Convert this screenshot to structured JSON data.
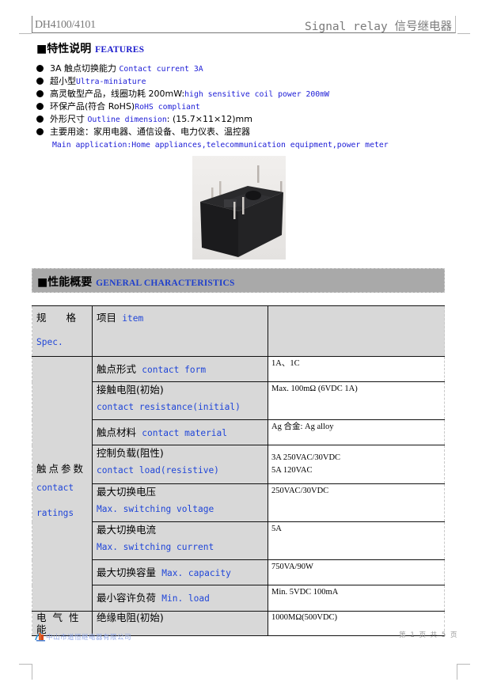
{
  "header": {
    "model": "DH4100/4101",
    "category": "Signal relay 信号继电器"
  },
  "features": {
    "title_zh": "■特性说明",
    "title_en": "FEATURES",
    "items": [
      {
        "zh": "3A 触点切换能力",
        "en": "Contact current 3A"
      },
      {
        "zh": "超小型",
        "en": "Ultra-miniature"
      },
      {
        "zh": "高灵敏型产品，线圈功耗 200mW:",
        "en": "high sensitive coil power 200mW"
      },
      {
        "zh": "环保产品(符合 RoHS)",
        "en": "RoHS compliant"
      },
      {
        "zh": "外形尺寸",
        "en": "Outline dimension",
        "suffix": ": (15.7×11×12)mm"
      },
      {
        "zh": "主要用途：家用电器、通信设备、电力仪表、温控器",
        "en": ""
      }
    ],
    "application_en": "Main application:Home appliances,telecommunication equipment,power meter"
  },
  "product_image": {
    "alt": "relay-photo"
  },
  "general": {
    "title_zh": "■性能概要",
    "title_en": "GENERAL CHARACTERISTICS"
  },
  "table": {
    "head": {
      "spec_zh": "规　　格",
      "spec_en": "Spec.",
      "item_zh": "项目",
      "item_en": "item",
      "value": ""
    },
    "group_contact": {
      "zh": "触点参数",
      "en1": "contact",
      "en2": "ratings"
    },
    "rows": [
      {
        "zh": "触点形式",
        "en": "contact form",
        "value": [
          "1A、1C"
        ]
      },
      {
        "zh": "接触电阻(初始)",
        "en": "contact resistance(initial)",
        "value": [
          "Max.  100mΩ  (6VDC  1A)"
        ]
      },
      {
        "zh": "触点材料",
        "en": "contact material",
        "value": [
          "Ag 合金:  Ag alloy"
        ]
      },
      {
        "zh": "控制负载(阻性)",
        "en": "contact load(resistive)",
        "value": [
          "3A   250VAC/30VDC",
          "5A   120VAC"
        ]
      },
      {
        "zh": "最大切换电压",
        "en": "Max.  switching  voltage",
        "value": [
          "250VAC/30VDC"
        ]
      },
      {
        "zh": "最大切换电流",
        "en": "Max.  switching  current",
        "value": [
          "5A"
        ]
      },
      {
        "zh": "最大切换容量",
        "en": "Max.  capacity",
        "value": [
          "750VA/90W"
        ]
      },
      {
        "zh": "最小容许负荷",
        "en": "Min.  load",
        "value": [
          "Min.  5VDC   100mA"
        ]
      }
    ],
    "group_electrical": {
      "zh": "电 气 性 能"
    },
    "electrical_rows": [
      {
        "zh": "绝缘电阻(初始)",
        "value": "1000MΩ(500VDC)"
      }
    ]
  },
  "footer": {
    "company": "中山市道恒继电器有限公司",
    "page": "第 1 页 共 5 页"
  }
}
